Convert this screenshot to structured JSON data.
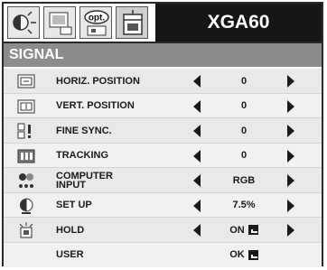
{
  "header": {
    "model": "XGA60",
    "opt_tab_label": "opt.",
    "tabs": [
      {
        "icon": "picture-adjust-icon"
      },
      {
        "icon": "image-icon"
      },
      {
        "icon": "options-icon"
      },
      {
        "icon": "signal-menu-icon",
        "active": true
      }
    ]
  },
  "section_title": "SIGNAL",
  "rows": [
    {
      "label": "HORIZ. POSITION",
      "value": "0",
      "icon": "horiz-position-icon",
      "arrows": true
    },
    {
      "label": "VERT. POSITION",
      "value": "0",
      "icon": "vert-position-icon",
      "arrows": true
    },
    {
      "label": "FINE SYNC.",
      "value": "0",
      "icon": "fine-sync-icon",
      "arrows": true
    },
    {
      "label": "TRACKING",
      "value": "0",
      "icon": "tracking-icon",
      "arrows": true
    },
    {
      "label": "COMPUTER INPUT",
      "value": "RGB",
      "icon": "computer-input-icon",
      "arrows": true
    },
    {
      "label": "SET UP",
      "value": "7.5%",
      "icon": "setup-icon",
      "arrows": true
    },
    {
      "label": "HOLD",
      "value": "ON",
      "icon": "hold-icon",
      "arrows": true,
      "enter": true
    },
    {
      "label": "USER",
      "value": "OK",
      "icon": null,
      "arrows": false,
      "enter": true
    }
  ]
}
